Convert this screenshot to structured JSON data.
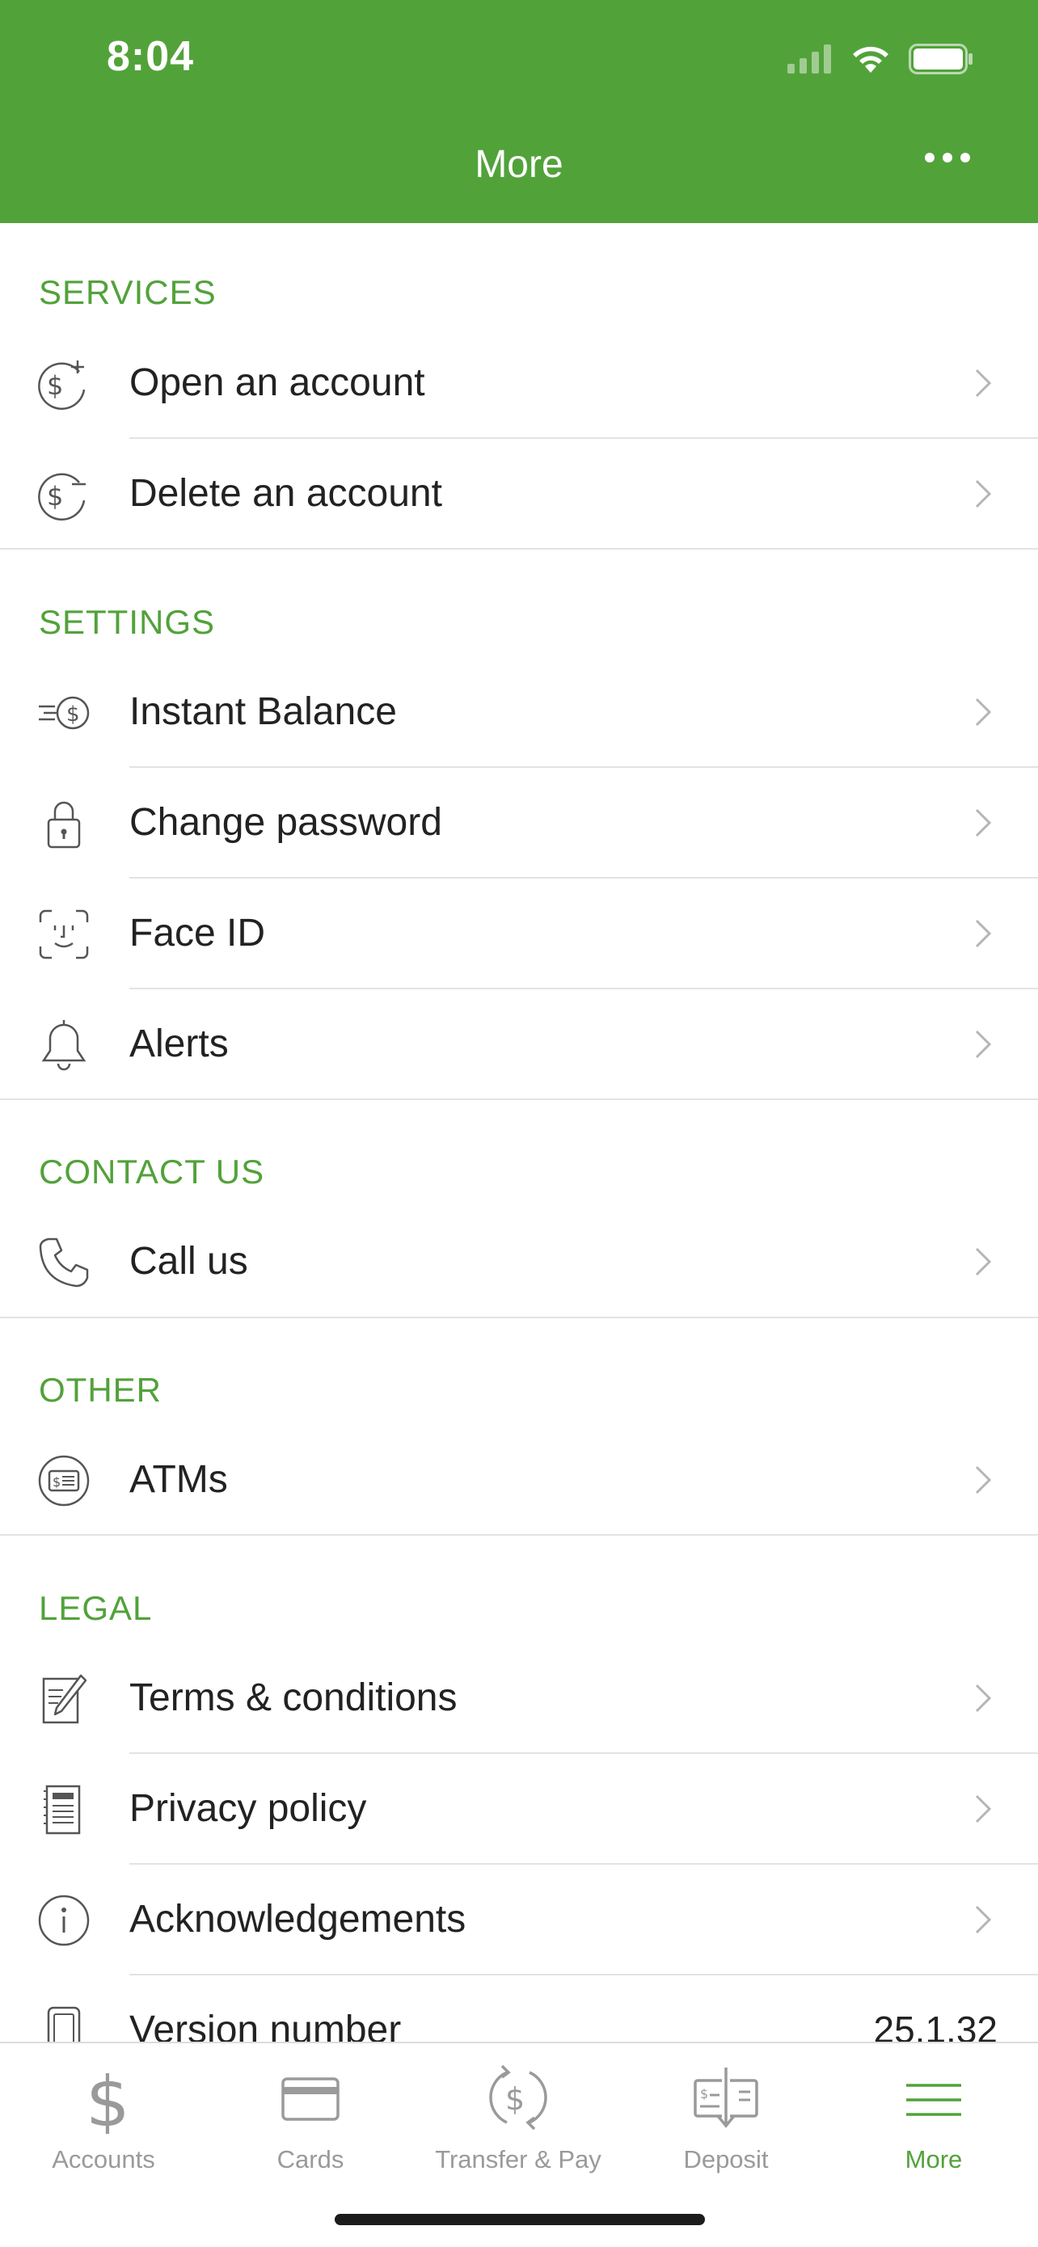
{
  "status_bar": {
    "time": "8:04"
  },
  "header": {
    "title": "More"
  },
  "sections": {
    "services": {
      "title": "SERVICES",
      "items": [
        {
          "label": "Open an account",
          "icon": "dollar-plus-icon"
        },
        {
          "label": "Delete an account",
          "icon": "dollar-minus-icon"
        }
      ]
    },
    "settings": {
      "title": "SETTINGS",
      "items": [
        {
          "label": "Instant Balance",
          "icon": "instant-balance-icon"
        },
        {
          "label": "Change password",
          "icon": "lock-icon"
        },
        {
          "label": "Face ID",
          "icon": "face-id-icon"
        },
        {
          "label": "Alerts",
          "icon": "bell-icon"
        }
      ]
    },
    "contact": {
      "title": "CONTACT US",
      "items": [
        {
          "label": "Call us",
          "icon": "phone-icon"
        }
      ]
    },
    "other": {
      "title": "OTHER",
      "items": [
        {
          "label": "ATMs",
          "icon": "atm-icon"
        }
      ]
    },
    "legal": {
      "title": "LEGAL",
      "items": [
        {
          "label": "Terms & conditions",
          "icon": "edit-document-icon"
        },
        {
          "label": "Privacy policy",
          "icon": "document-icon"
        },
        {
          "label": "Acknowledgements",
          "icon": "info-icon"
        },
        {
          "label": "Version number",
          "icon": "phone-device-icon",
          "value": "25.1.32"
        }
      ]
    }
  },
  "tabbar": {
    "accent_color": "#52a23a",
    "tabs": [
      {
        "label": "Accounts",
        "icon": "dollar-icon",
        "active": false
      },
      {
        "label": "Cards",
        "icon": "card-icon",
        "active": false
      },
      {
        "label": "Transfer & Pay",
        "icon": "transfer-pay-icon",
        "active": false
      },
      {
        "label": "Deposit",
        "icon": "deposit-check-icon",
        "active": false
      },
      {
        "label": "More",
        "icon": "menu-icon",
        "active": true
      }
    ]
  }
}
